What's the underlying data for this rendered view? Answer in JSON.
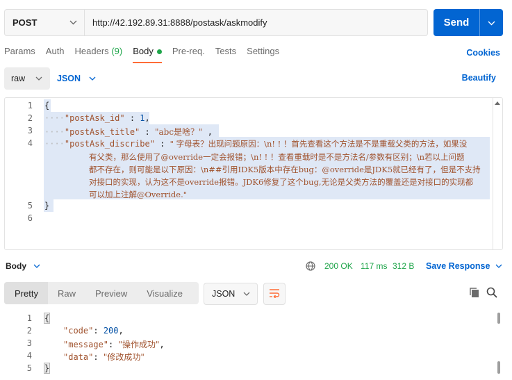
{
  "request": {
    "method": "POST",
    "url": "http://42.192.89.31:8888/postask/askmodify",
    "send_label": "Send"
  },
  "tabs": {
    "params": "Params",
    "auth": "Auth",
    "headers": "Headers",
    "headers_count": "(9)",
    "body": "Body",
    "prereq": "Pre-req.",
    "tests": "Tests",
    "settings": "Settings",
    "cookies": "Cookies"
  },
  "body_options": {
    "mode": "raw",
    "language": "JSON",
    "beautify": "Beautify"
  },
  "request_body": {
    "line_numbers": [
      "1",
      "2",
      "3",
      "4",
      "5",
      "6"
    ],
    "l1": "{",
    "id_key": "\"postAsk_id\"",
    "id_val": "1",
    "title_key": "\"postAsk_title\"",
    "title_val": "\"abc是啥？\"",
    "disc_key": "\"postAsk_discribe\"",
    "disc_val_1": "\" 字母表？出现问题原因：\\n! ! ！首先查看这个方法是不是重载父类的方法，如果没",
    "disc_val_2": "有父类，那么使用了@override一定会报错；\\n! ! ！查看重载时是不是方法名/参数有区别；\\n若以上问题",
    "disc_val_3": "都不存在，则可能是以下原因：\\n##引用IDK5版本中存在bug：@override是JDK5就已经有了，但是不支持",
    "disc_val_4": "对接口的实现，认为这不是override报错。JDK6修复了这个bug,无论是父类方法的覆盖还是对接口的实现都",
    "disc_val_5": "可以加上注解@Override.\"",
    "l5": "}"
  },
  "response": {
    "body_label": "Body",
    "status": "200 OK",
    "time": "117 ms",
    "size": "312 B",
    "save": "Save Response",
    "tabs": [
      "Pretty",
      "Raw",
      "Preview",
      "Visualize"
    ],
    "format": "JSON",
    "line_numbers": [
      "1",
      "2",
      "3",
      "4",
      "5"
    ],
    "l1": "{",
    "code_key": "\"code\"",
    "code_val": "200",
    "message_key": "\"message\"",
    "message_val": "\"操作成功\"",
    "data_key": "\"data\"",
    "data_val": "\"修改成功\"",
    "l5": "}"
  },
  "colors": {
    "accent_blue": "#0265d2",
    "active_tab_orange": "#ff6c37",
    "status_green": "#1fa54a",
    "json_key": "#a0522d",
    "json_number": "#0451a5"
  }
}
